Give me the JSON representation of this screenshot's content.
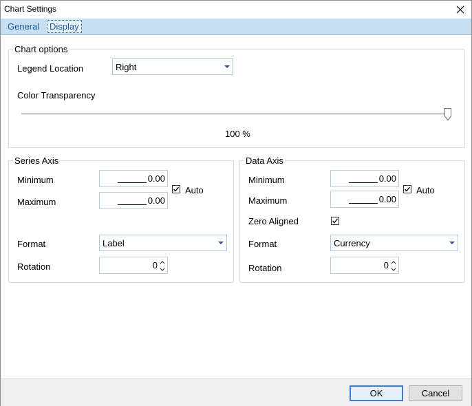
{
  "window": {
    "title": "Chart Settings"
  },
  "tabs": [
    {
      "label": "General",
      "active": false
    },
    {
      "label": "Display",
      "active": true
    }
  ],
  "chart_options": {
    "group_title": "Chart options",
    "legend_label": "Legend Location",
    "legend_value": "Right",
    "transparency_label": "Color Transparency",
    "transparency_value": "100 %",
    "transparency_level_percent": 100
  },
  "series_axis": {
    "group_title": "Series Axis",
    "min_label": "Minimum",
    "min_value": "0.00",
    "max_label": "Maximum",
    "max_value": "0.00",
    "auto_label": "Auto",
    "auto_checked": true,
    "format_label": "Format",
    "format_value": "Label",
    "rotation_label": "Rotation",
    "rotation_value": "0"
  },
  "data_axis": {
    "group_title": "Data Axis",
    "min_label": "Minimum",
    "min_value": "0.00",
    "max_label": "Maximum",
    "max_value": "0.00",
    "auto_label": "Auto",
    "auto_checked": true,
    "zero_label": "Zero Aligned",
    "zero_checked": true,
    "format_label": "Format",
    "format_value": "Currency",
    "rotation_label": "Rotation",
    "rotation_value": "0"
  },
  "footer": {
    "ok_label": "OK",
    "cancel_label": "Cancel"
  },
  "colors": {
    "tab_strip": "#c6dff3",
    "accent": "#3e7ed0",
    "tab_text": "#1e5aa0"
  }
}
